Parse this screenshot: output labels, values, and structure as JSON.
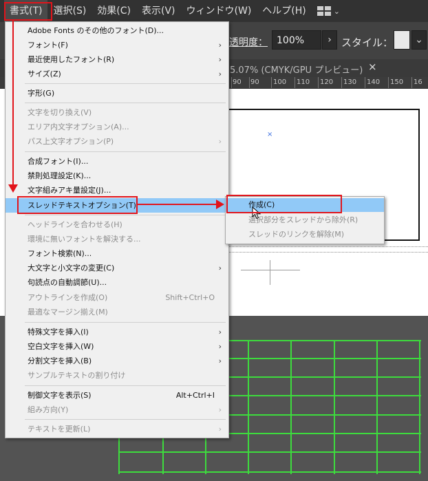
{
  "menubar": {
    "items": [
      "書式(T)",
      "選択(S)",
      "効果(C)",
      "表示(V)",
      "ウィンドウ(W)",
      "ヘルプ(H)"
    ],
    "workspace_icon": "workspace-layout-icon"
  },
  "controlbar": {
    "opacity_label": "透明度：",
    "opacity_value": "100%",
    "style_label": "スタイル："
  },
  "document": {
    "tab_title": "5.07% (CMYK/GPU プレビュー)",
    "close_glyph": "×",
    "ruler_ticks": [
      "90",
      "90",
      "100",
      "110",
      "120",
      "130",
      "140",
      "150",
      "16"
    ]
  },
  "menu": {
    "items": [
      {
        "label": "Adobe Fonts のその他のフォント(D)...",
        "shortcut": "",
        "submenu": false,
        "disabled": false
      },
      {
        "label": "フォント(F)",
        "shortcut": "",
        "submenu": true,
        "disabled": false
      },
      {
        "label": "最近使用したフォント(R)",
        "shortcut": "",
        "submenu": true,
        "disabled": false
      },
      {
        "label": "サイズ(Z)",
        "shortcut": "",
        "submenu": true,
        "disabled": false
      },
      {
        "label": "字形(G)",
        "shortcut": "",
        "submenu": false,
        "disabled": false
      },
      {
        "label": "文字を切り換え(V)",
        "shortcut": "",
        "submenu": false,
        "disabled": true
      },
      {
        "label": "エリア内文字オプション(A)...",
        "shortcut": "",
        "submenu": false,
        "disabled": true
      },
      {
        "label": "パス上文字オプション(P)",
        "shortcut": "",
        "submenu": true,
        "disabled": true
      },
      {
        "label": "合成フォント(I)...",
        "shortcut": "",
        "submenu": false,
        "disabled": false
      },
      {
        "label": "禁則処理設定(K)...",
        "shortcut": "",
        "submenu": false,
        "disabled": false
      },
      {
        "label": "文字組みアキ量設定(J)...",
        "shortcut": "",
        "submenu": false,
        "disabled": false
      },
      {
        "label": "スレッドテキストオプション(T)",
        "shortcut": "",
        "submenu": true,
        "disabled": false,
        "highlighted": true
      },
      {
        "label": "ヘッドラインを合わせる(H)",
        "shortcut": "",
        "submenu": false,
        "disabled": true
      },
      {
        "label": "環境に無いフォントを解決する...",
        "shortcut": "",
        "submenu": false,
        "disabled": true
      },
      {
        "label": "フォント検索(N)...",
        "shortcut": "",
        "submenu": false,
        "disabled": false
      },
      {
        "label": "大文字と小文字の変更(C)",
        "shortcut": "",
        "submenu": true,
        "disabled": false
      },
      {
        "label": "句読点の自動調節(U)...",
        "shortcut": "",
        "submenu": false,
        "disabled": false
      },
      {
        "label": "アウトラインを作成(O)",
        "shortcut": "Shift+Ctrl+O",
        "submenu": false,
        "disabled": true
      },
      {
        "label": "最適なマージン揃え(M)",
        "shortcut": "",
        "submenu": false,
        "disabled": true
      },
      {
        "label": "特殊文字を挿入(I)",
        "shortcut": "",
        "submenu": true,
        "disabled": false
      },
      {
        "label": "空白文字を挿入(W)",
        "shortcut": "",
        "submenu": true,
        "disabled": false
      },
      {
        "label": "分割文字を挿入(B)",
        "shortcut": "",
        "submenu": true,
        "disabled": false
      },
      {
        "label": "サンプルテキストの割り付け",
        "shortcut": "",
        "submenu": false,
        "disabled": true
      },
      {
        "label": "制御文字を表示(S)",
        "shortcut": "Alt+Ctrl+I",
        "submenu": false,
        "disabled": false
      },
      {
        "label": "組み方向(Y)",
        "shortcut": "",
        "submenu": true,
        "disabled": true
      },
      {
        "label": "テキストを更新(L)",
        "shortcut": "",
        "submenu": true,
        "disabled": true
      }
    ]
  },
  "submenu": {
    "items": [
      {
        "label": "作成(C)",
        "disabled": false,
        "highlighted": true
      },
      {
        "label": "選択部分をスレッドから除外(R)",
        "disabled": true
      },
      {
        "label": "スレッドのリンクを解除(M)",
        "disabled": true
      }
    ]
  },
  "colors": {
    "annotation_red": "#e2141b",
    "highlight_blue": "#91c9f7",
    "grid_green": "#3ddc3d"
  }
}
